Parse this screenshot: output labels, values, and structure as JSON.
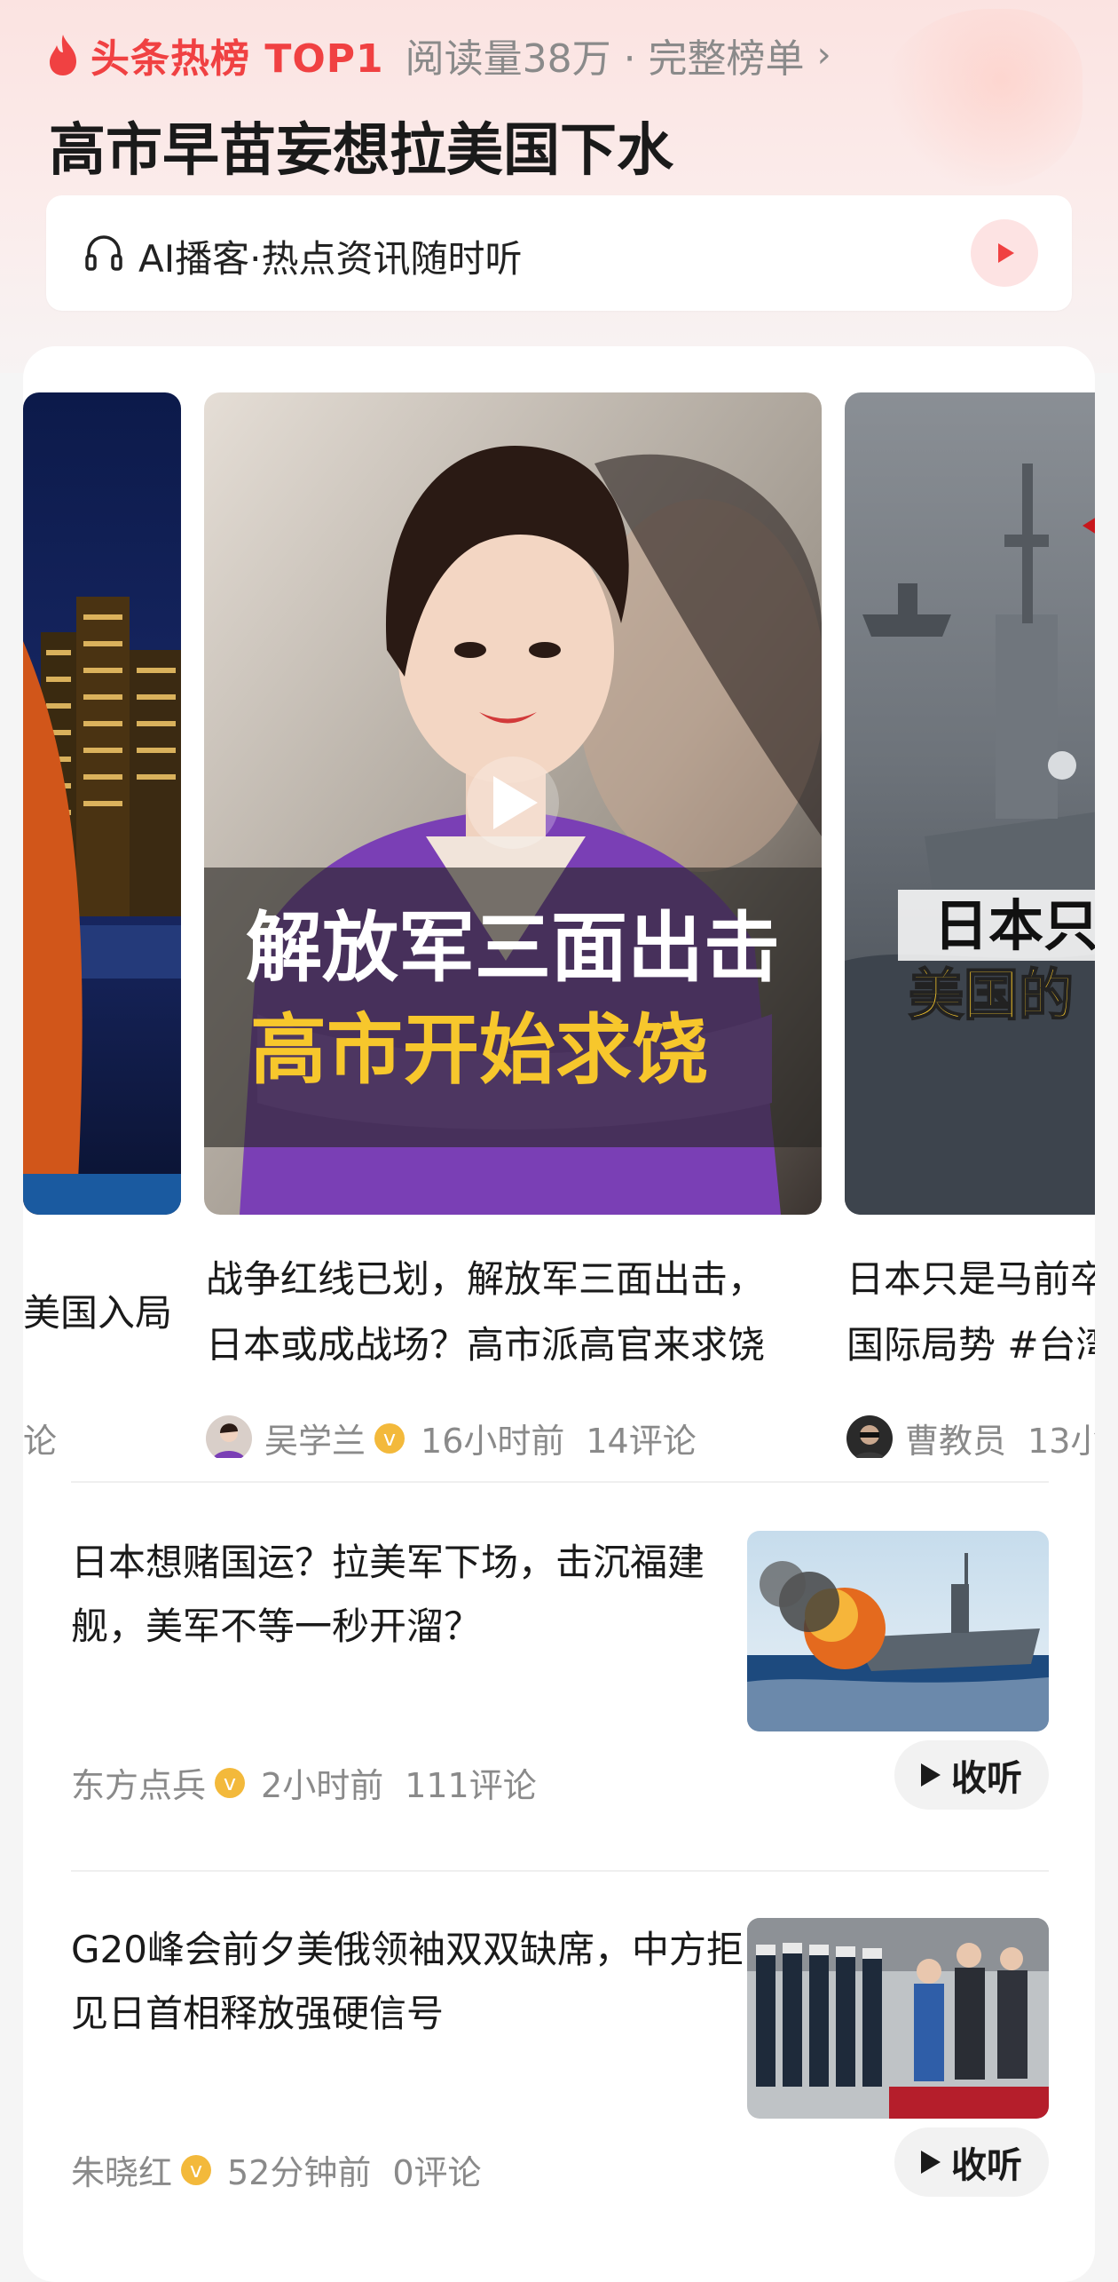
{
  "header": {
    "hot_label": "头条热榜 TOP1",
    "meta": "阅读量38万 · 完整榜单",
    "headline": "高市早苗妄想拉美国下水"
  },
  "podcast": {
    "label": "AI播客·热点资讯随时听"
  },
  "carousel": {
    "left": {
      "title_1": "美国入局",
      "meta": "论"
    },
    "center": {
      "overlay_line1": "解放军三面出击",
      "overlay_line2": "高市开始求饶",
      "title_1": "战争红线已划，解放军三面出击，",
      "title_2": "日本或成战场？高市派高官来求饶",
      "author": "吴学兰",
      "time": "16小时前",
      "comments": "14评论"
    },
    "right": {
      "overlay_line1": "日本只",
      "overlay_line2": "美国的",
      "title_1": "日本只是马前卒",
      "title_2": "国际局势 #台湾",
      "author": "曹教员",
      "time": "13小"
    }
  },
  "articles": [
    {
      "title": "日本想赌国运？拉美军下场，击沉福建舰，美军不等一秒开溜？",
      "author": "东方点兵",
      "time": "2小时前",
      "comments": "111评论",
      "listen": "收听"
    },
    {
      "title": "G20峰会前夕美俄领袖双双缺席，中方拒见日首相释放强硬信号",
      "author": "朱晓红",
      "time": "52分钟前",
      "comments": "0评论",
      "listen": "收听"
    }
  ],
  "colors": {
    "hot": "#f04142",
    "meta": "#8a8a8a",
    "badge": "#f3b93b",
    "overlay_white": "#ffffff",
    "overlay_yellow": "#f7c72c"
  },
  "icons": [
    "fire-icon",
    "chevron-right-icon",
    "headphones-icon",
    "play-icon",
    "verified-icon"
  ]
}
